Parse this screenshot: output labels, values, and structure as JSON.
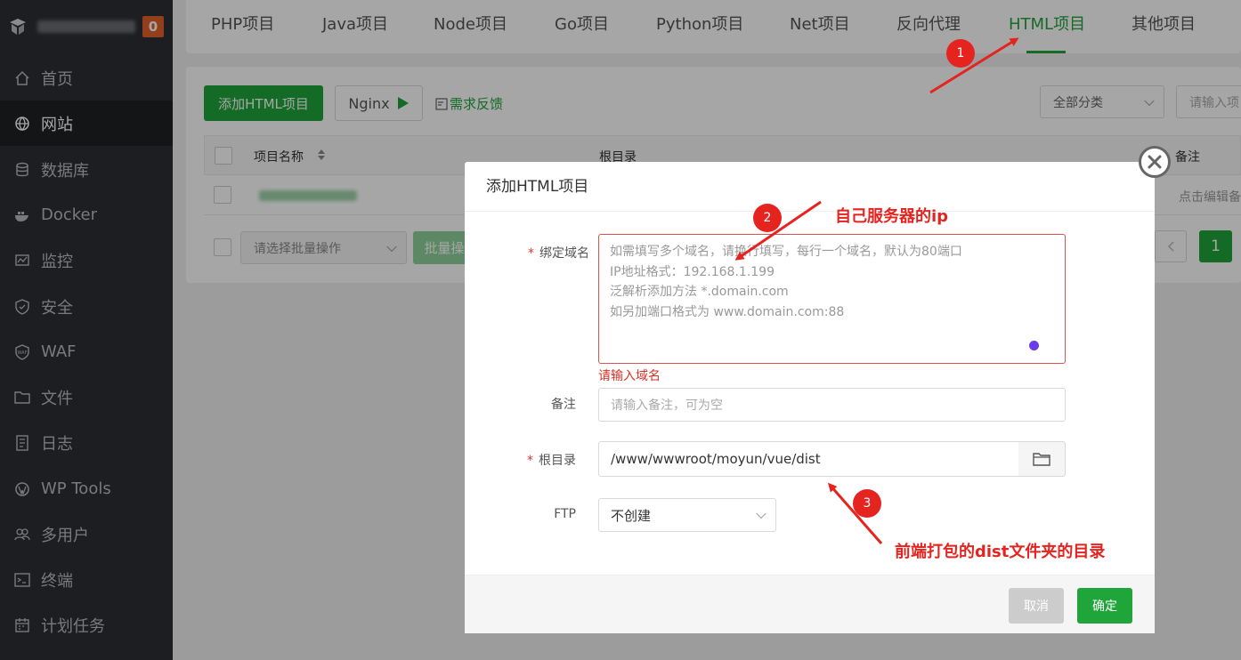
{
  "sidebar": {
    "badge": "0",
    "items": [
      {
        "label": "首页",
        "icon": "home-icon"
      },
      {
        "label": "网站",
        "icon": "globe-icon"
      },
      {
        "label": "数据库",
        "icon": "database-icon"
      },
      {
        "label": "Docker",
        "icon": "docker-icon"
      },
      {
        "label": "监控",
        "icon": "monitor-icon"
      },
      {
        "label": "安全",
        "icon": "shield-icon"
      },
      {
        "label": "WAF",
        "icon": "waf-shield-icon"
      },
      {
        "label": "文件",
        "icon": "folder-icon"
      },
      {
        "label": "日志",
        "icon": "log-icon"
      },
      {
        "label": "WP Tools",
        "icon": "wordpress-icon"
      },
      {
        "label": "多用户",
        "icon": "users-icon"
      },
      {
        "label": "终端",
        "icon": "terminal-icon"
      },
      {
        "label": "计划任务",
        "icon": "calendar-icon"
      }
    ],
    "active_index": 1
  },
  "tabs": [
    "PHP项目",
    "Java项目",
    "Node项目",
    "Go项目",
    "Python项目",
    "Net项目",
    "反向代理",
    "HTML项目",
    "其他项目"
  ],
  "active_tab": "HTML项目",
  "toolbar": {
    "add_button": "添加HTML项目",
    "nginx_button": "Nginx",
    "feedback_link": "需求反馈",
    "category_select": "全部分类",
    "search_placeholder": "请输入项"
  },
  "table": {
    "col_name": "项目名称",
    "col_root": "根目录",
    "col_note": "备注",
    "row_note": "点击编辑备",
    "batch_select": "请选择批量操作",
    "batch_button": "批量操",
    "page": "1"
  },
  "modal": {
    "title": "添加HTML项目",
    "domain_label": "绑定域名",
    "domain_placeholder_lines": [
      "如需填写多个域名，请换行填写，每行一个域名，默认为80端口",
      "IP地址格式：192.168.1.199",
      "泛解析添加方法 *.domain.com",
      "如另加端口格式为 www.domain.com:88"
    ],
    "domain_error": "请输入域名",
    "note_label": "备注",
    "note_placeholder": "请输入备注，可为空",
    "root_label": "根目录",
    "root_value": "/www/wwwroot/moyun/vue/dist",
    "ftp_label": "FTP",
    "ftp_value": "不创建",
    "cancel_button": "取消",
    "ok_button": "确定"
  },
  "annotations": [
    {
      "number": "1",
      "text": ""
    },
    {
      "number": "2",
      "text": "自己服务器的ip"
    },
    {
      "number": "3",
      "text": "前端打包的dist文件夹的目录"
    }
  ],
  "colors": {
    "accent": "#20a53a",
    "annotation": "#e5231f",
    "sidebar_bg": "#2c2f33",
    "badge": "#e2612b"
  }
}
